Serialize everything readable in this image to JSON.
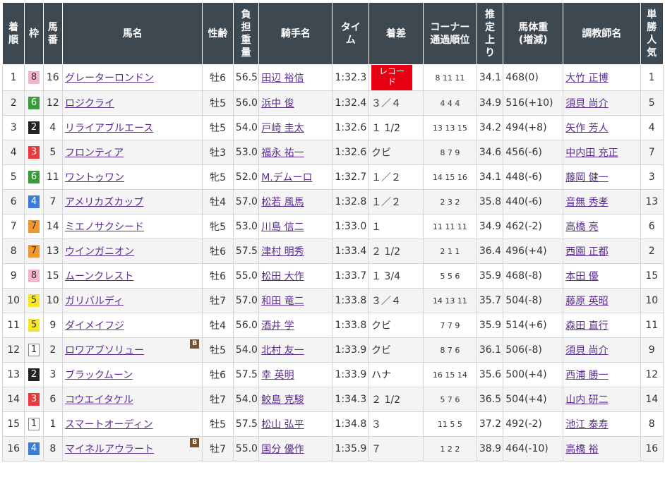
{
  "headers": {
    "rank": "着\n順",
    "waku": "枠",
    "umaban": "馬\n番",
    "horse": "馬名",
    "sexage": "性齢",
    "weight": "負\n担\n重\n量",
    "jockey": "騎手名",
    "time": "タイ\nム",
    "margin": "着差",
    "corner": "コーナー\n通過順位",
    "last3f": "推\n定\n上\nり",
    "bodyweight": "馬体重\n(増減)",
    "trainer": "調教師名",
    "popularity": "単\n勝\n人\n気"
  },
  "blinker_label": "B",
  "record_label": "レコー\nド",
  "rows": [
    {
      "rank": "1",
      "waku": "8",
      "umaban": "16",
      "horse": "グレーターロンドン",
      "blinker": false,
      "sexage": "牡6",
      "weight": "56.5",
      "jockey": "田辺 裕信",
      "time": "1:32.3",
      "margin": "",
      "record": true,
      "corner": "8 11 11",
      "last3f": "34.1",
      "bodyweight": "468(0)",
      "trainer": "大竹 正博",
      "popularity": "1"
    },
    {
      "rank": "2",
      "waku": "6",
      "umaban": "12",
      "horse": "ロジクライ",
      "blinker": false,
      "sexage": "牡5",
      "weight": "56.0",
      "jockey": "浜中 俊",
      "time": "1:32.4",
      "margin": "３／４",
      "record": false,
      "corner": "4 4 4",
      "last3f": "34.9",
      "bodyweight": "516(+10)",
      "trainer": "須貝 尚介",
      "popularity": "5"
    },
    {
      "rank": "3",
      "waku": "2",
      "umaban": "4",
      "horse": "リライアブルエース",
      "blinker": false,
      "sexage": "牡5",
      "weight": "54.0",
      "jockey": "戸崎 圭太",
      "time": "1:32.6",
      "margin": "１ 1/2",
      "record": false,
      "corner": "13 13 15",
      "last3f": "34.2",
      "bodyweight": "494(+8)",
      "trainer": "矢作 芳人",
      "popularity": "4"
    },
    {
      "rank": "4",
      "waku": "3",
      "umaban": "5",
      "horse": "フロンティア",
      "blinker": false,
      "sexage": "牡3",
      "weight": "53.0",
      "jockey": "福永 祐一",
      "time": "1:32.6",
      "margin": "クビ",
      "record": false,
      "corner": "8 7 9",
      "last3f": "34.6",
      "bodyweight": "456(-6)",
      "trainer": "中内田 充正",
      "popularity": "7"
    },
    {
      "rank": "5",
      "waku": "6",
      "umaban": "11",
      "horse": "ワントゥワン",
      "blinker": false,
      "sexage": "牝5",
      "weight": "52.0",
      "jockey": "M.デムーロ",
      "time": "1:32.7",
      "margin": "１／２",
      "record": false,
      "corner": "14 15 16",
      "last3f": "34.1",
      "bodyweight": "448(-6)",
      "trainer": "藤岡 健一",
      "popularity": "3"
    },
    {
      "rank": "6",
      "waku": "4",
      "umaban": "7",
      "horse": "アメリカズカップ",
      "blinker": false,
      "sexage": "牡4",
      "weight": "57.0",
      "jockey": "松若 風馬",
      "time": "1:32.8",
      "margin": "１／２",
      "record": false,
      "corner": "2 3 2",
      "last3f": "35.8",
      "bodyweight": "440(-6)",
      "trainer": "音無 秀孝",
      "popularity": "13"
    },
    {
      "rank": "7",
      "waku": "7",
      "umaban": "14",
      "horse": "ミエノサクシード",
      "blinker": false,
      "sexage": "牝5",
      "weight": "53.0",
      "jockey": "川島 信二",
      "time": "1:33.0",
      "margin": "１",
      "record": false,
      "corner": "11 11 11",
      "last3f": "34.9",
      "bodyweight": "462(-2)",
      "trainer": "高橋 亮",
      "popularity": "6"
    },
    {
      "rank": "8",
      "waku": "7",
      "umaban": "13",
      "horse": "ウインガニオン",
      "blinker": false,
      "sexage": "牡6",
      "weight": "57.5",
      "jockey": "津村 明秀",
      "time": "1:33.4",
      "margin": "２ 1/2",
      "record": false,
      "corner": "2 1 1",
      "last3f": "36.4",
      "bodyweight": "496(+4)",
      "trainer": "西園 正都",
      "popularity": "2"
    },
    {
      "rank": "9",
      "waku": "8",
      "umaban": "15",
      "horse": "ムーンクレスト",
      "blinker": false,
      "sexage": "牡6",
      "weight": "55.0",
      "jockey": "松田 大作",
      "time": "1:33.7",
      "margin": "１ 3/4",
      "record": false,
      "corner": "5 5 6",
      "last3f": "35.9",
      "bodyweight": "468(-8)",
      "trainer": "本田 優",
      "popularity": "15"
    },
    {
      "rank": "10",
      "waku": "5",
      "umaban": "10",
      "horse": "ガリバルディ",
      "blinker": false,
      "sexage": "牡7",
      "weight": "57.0",
      "jockey": "和田 竜二",
      "time": "1:33.8",
      "margin": "３／４",
      "record": false,
      "corner": "14 13 11",
      "last3f": "35.7",
      "bodyweight": "504(-8)",
      "trainer": "藤原 英昭",
      "popularity": "10"
    },
    {
      "rank": "11",
      "waku": "5",
      "umaban": "9",
      "horse": "ダイメイフジ",
      "blinker": false,
      "sexage": "牡4",
      "weight": "56.0",
      "jockey": "酒井 学",
      "time": "1:33.8",
      "margin": "クビ",
      "record": false,
      "corner": "7 7 9",
      "last3f": "35.9",
      "bodyweight": "514(+6)",
      "trainer": "森田 直行",
      "popularity": "11"
    },
    {
      "rank": "12",
      "waku": "1",
      "umaban": "2",
      "horse": "ロワアブソリュー",
      "blinker": true,
      "sexage": "牡5",
      "weight": "54.0",
      "jockey": "北村 友一",
      "time": "1:33.9",
      "margin": "クビ",
      "record": false,
      "corner": "8 7 6",
      "last3f": "36.1",
      "bodyweight": "506(-8)",
      "trainer": "須貝 尚介",
      "popularity": "9"
    },
    {
      "rank": "13",
      "waku": "2",
      "umaban": "3",
      "horse": "ブラックムーン",
      "blinker": false,
      "sexage": "牡6",
      "weight": "57.5",
      "jockey": "幸 英明",
      "time": "1:33.9",
      "margin": "ハナ",
      "record": false,
      "corner": "16 15 14",
      "last3f": "35.6",
      "bodyweight": "500(+4)",
      "trainer": "西浦 勝一",
      "popularity": "12"
    },
    {
      "rank": "14",
      "waku": "3",
      "umaban": "6",
      "horse": "コウエイタケル",
      "blinker": false,
      "sexage": "牡7",
      "weight": "54.0",
      "jockey": "鮫島 克駿",
      "time": "1:34.3",
      "margin": "２ 1/2",
      "record": false,
      "corner": "5 7 6",
      "last3f": "36.5",
      "bodyweight": "504(+4)",
      "trainer": "山内 研二",
      "popularity": "14"
    },
    {
      "rank": "15",
      "waku": "1",
      "umaban": "1",
      "horse": "スマートオーディン",
      "blinker": false,
      "sexage": "牡5",
      "weight": "57.5",
      "jockey": "松山 弘平",
      "time": "1:34.8",
      "margin": "３",
      "record": false,
      "corner": "11 5 5",
      "last3f": "37.2",
      "bodyweight": "492(-2)",
      "trainer": "池江 泰寿",
      "popularity": "8"
    },
    {
      "rank": "16",
      "waku": "4",
      "umaban": "8",
      "horse": "マイネルアウラート",
      "blinker": true,
      "sexage": "牡7",
      "weight": "55.0",
      "jockey": "国分 優作",
      "time": "1:35.9",
      "margin": "７",
      "record": false,
      "corner": "1 2 2",
      "last3f": "38.9",
      "bodyweight": "464(-10)",
      "trainer": "高橋 裕",
      "popularity": "16"
    }
  ]
}
